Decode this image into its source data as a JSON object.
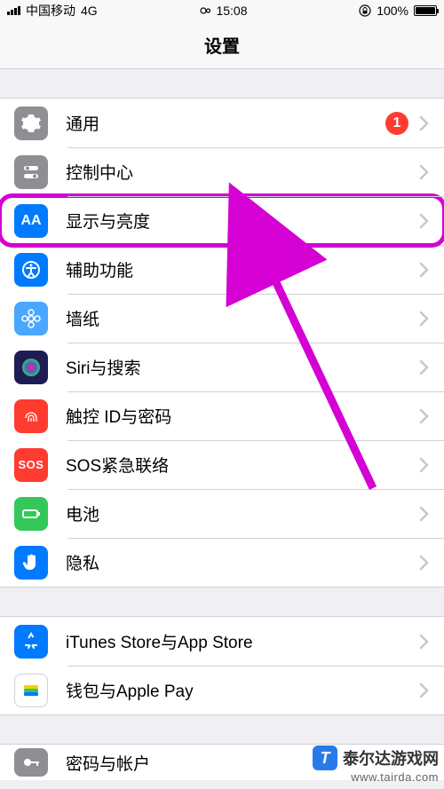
{
  "status": {
    "carrier": "中国移动",
    "network": "4G",
    "time": "15:08",
    "battery_pct": "100%"
  },
  "nav": {
    "title": "设置"
  },
  "group1": {
    "general": {
      "label": "通用",
      "badge": "1"
    },
    "control": {
      "label": "控制中心"
    },
    "display": {
      "label": "显示与亮度"
    },
    "access": {
      "label": "辅助功能"
    },
    "wallpaper": {
      "label": "墙纸"
    },
    "siri": {
      "label": "Siri与搜索"
    },
    "touchid": {
      "label": "触控 ID与密码"
    },
    "sos": {
      "label": "SOS紧急联络",
      "icon_text": "SOS"
    },
    "battery": {
      "label": "电池"
    },
    "privacy": {
      "label": "隐私"
    }
  },
  "group2": {
    "itunes": {
      "label": "iTunes Store与App Store"
    },
    "wallet": {
      "label": "钱包与Apple Pay"
    }
  },
  "group3": {
    "accounts": {
      "label": "密码与帐户"
    }
  },
  "watermark": {
    "brand": "泰尔达游戏网",
    "url": "www.tairda.com",
    "badge": "T"
  }
}
